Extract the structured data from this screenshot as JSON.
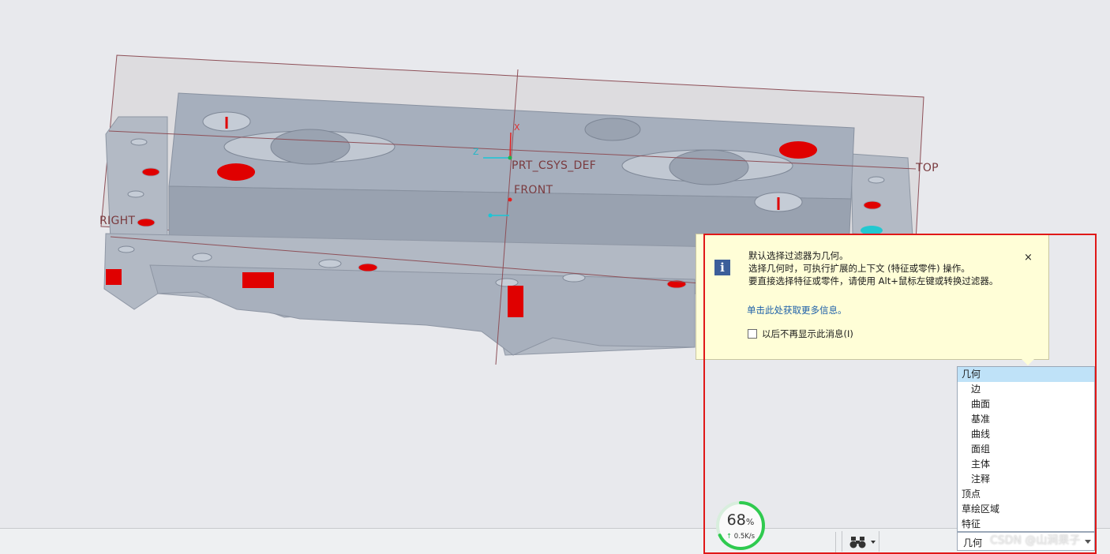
{
  "viewport": {
    "plane_labels": {
      "top": "TOP",
      "right": "RIGHT",
      "front": "FRONT",
      "csys": "PRT_CSYS_DEF"
    },
    "axis_labels": {
      "x": "X",
      "z": "Z"
    }
  },
  "info_popup": {
    "icon": "info-icon",
    "line1": "默认选择过滤器为几何。",
    "line2": "选择几何时，可执行扩展的上下文 (特征或零件) 操作。",
    "line3": "要直接选择特征或零件，请使用 Alt+鼠标左键或转换过滤器。",
    "link": "单击此处获取更多信息。",
    "checkbox_label": "以后不再显示此消息(I)",
    "checkbox_checked": false,
    "close_label": "×"
  },
  "filter_list": {
    "items": [
      {
        "label": "几何",
        "selected": true
      },
      {
        "label": "边"
      },
      {
        "label": "曲面"
      },
      {
        "label": "基准"
      },
      {
        "label": "曲线"
      },
      {
        "label": "面组"
      },
      {
        "label": "主体"
      },
      {
        "label": "注释"
      },
      {
        "label": "顶点"
      },
      {
        "label": "草绘区域"
      },
      {
        "label": "特征"
      }
    ]
  },
  "filter_select": {
    "value": "几何"
  },
  "status_bar": {
    "find_icon": "binoculars-icon"
  },
  "net_widget": {
    "percent": "68",
    "percent_unit": "%",
    "speed": "0.5K/s",
    "progress": 0.68
  },
  "watermark": "CSDN @山涧果子",
  "colors": {
    "highlight": "#e01818",
    "part": "#a4adbb",
    "hole_red": "#e00000",
    "popup_bg": "#fffed7",
    "selected_bg": "#bfe2f8"
  }
}
